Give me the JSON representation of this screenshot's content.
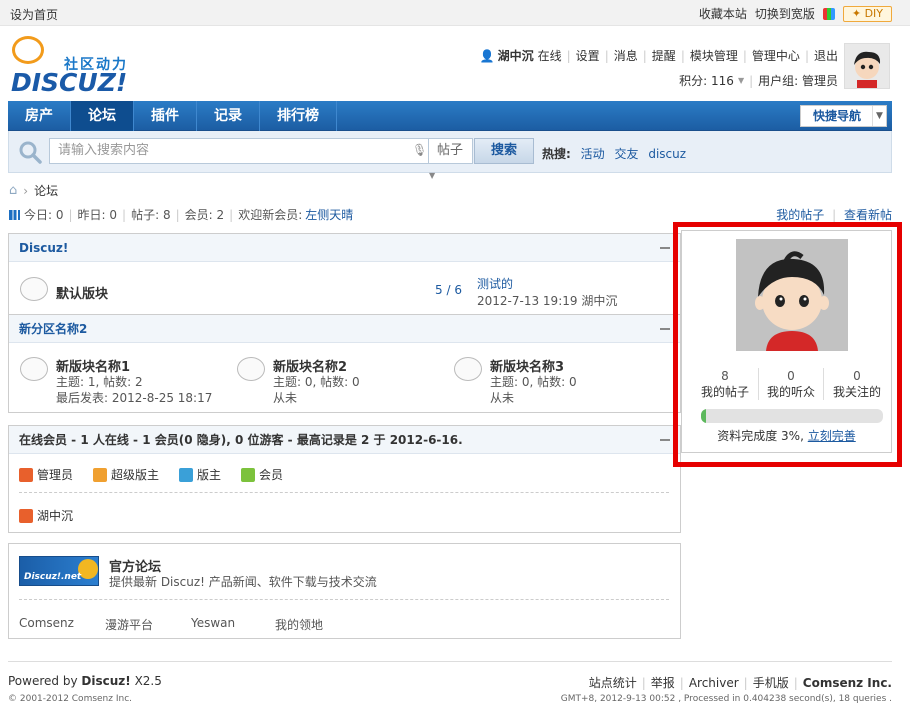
{
  "topbar": {
    "left": "设为首页",
    "bookmark": "收藏本站",
    "switch": "切换到宽版",
    "diy": "DIY"
  },
  "logo": {
    "cn": "社区动力",
    "en": "DISCUZ!"
  },
  "user": {
    "name": "湖中沉",
    "status": "在线",
    "links": [
      "设置",
      "消息",
      "提醒",
      "模块管理",
      "管理中心",
      "退出"
    ],
    "points_label": "积分: 116",
    "group": "用户组: 管理员"
  },
  "nav": {
    "items": [
      "房产",
      "论坛",
      "插件",
      "记录",
      "排行榜"
    ],
    "active": 1,
    "quick": "快捷导航"
  },
  "search": {
    "placeholder": "请输入搜索内容",
    "type": "帖子",
    "button": "搜索",
    "hot_label": "热搜:",
    "hot": [
      "活动",
      "交友",
      "discuz"
    ]
  },
  "breadcrumb": {
    "current": "论坛"
  },
  "stats": {
    "today": "今日: 0",
    "yesterday": "昨日: 0",
    "posts": "帖子: 8",
    "members": "会员: 2",
    "welcome": "欢迎新会员:",
    "new_member": "左侧天晴"
  },
  "mylinks": {
    "myposts": "我的帖子",
    "newposts": "查看新帖"
  },
  "cat1": {
    "title": "Discuz!",
    "forum": {
      "name": "默认版块",
      "count": "5",
      "total": "6",
      "last_title": "测试的",
      "last_time": "2012-7-13 19:19 湖中沉"
    }
  },
  "cat2": {
    "title": "新分区名称2",
    "forums": [
      {
        "name": "新版块名称1",
        "stat": "主题: 1, 帖数: 2",
        "last": "最后发表: 2012-8-25 18:17"
      },
      {
        "name": "新版块名称2",
        "stat": "主题: 0, 帖数: 0",
        "last": "从未"
      },
      {
        "name": "新版块名称3",
        "stat": "主题: 0, 帖数: 0",
        "last": "从未"
      }
    ]
  },
  "online": {
    "title": "在线会员 - 1 人在线 - 1 会员(0 隐身), 0 位游客 - 最高记录是 2 于 2012-6-16.",
    "roles": [
      "管理员",
      "超级版主",
      "版主",
      "会员"
    ],
    "users": [
      "湖中沉"
    ]
  },
  "links": {
    "name": "官方论坛",
    "desc": "提供最新 Discuz! 产品新闻、软件下载与技术交流",
    "logo_text": "Discuz!.net",
    "items": [
      "Comsenz",
      "漫游平台",
      "Yeswan",
      "我的领地"
    ]
  },
  "profile": {
    "stats": [
      {
        "n": "8",
        "label": "我的帖子"
      },
      {
        "n": "0",
        "label": "我的听众"
      },
      {
        "n": "0",
        "label": "我关注的"
      }
    ],
    "progress": 3,
    "progress_text": "资料完成度 3%,",
    "complete_link": "立刻完善"
  },
  "footer": {
    "powered": "Powered by",
    "brand": "Discuz!",
    "version": "X2.5",
    "copyright": "© 2001-2012 Comsenz Inc.",
    "links": [
      "站点统计",
      "举报",
      "Archiver",
      "手机版"
    ],
    "company": "Comsenz Inc.",
    "time": "GMT+8, 2012-9-13 00:52 , Processed in 0.404238 second(s), 18 queries ."
  },
  "colors": {
    "accent": "#1d5aa0",
    "highlight": "#e60000"
  }
}
